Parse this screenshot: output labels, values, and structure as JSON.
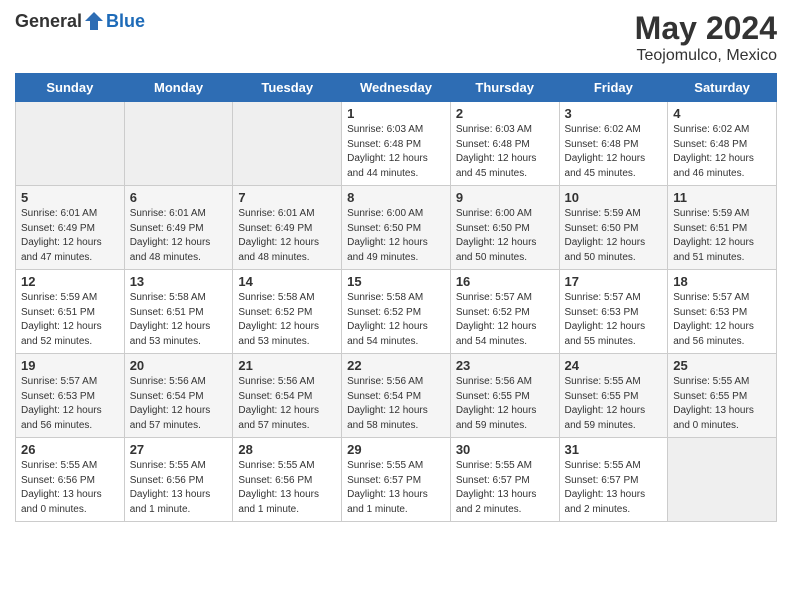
{
  "header": {
    "logo_general": "General",
    "logo_blue": "Blue",
    "month": "May 2024",
    "location": "Teojomulco, Mexico"
  },
  "days_of_week": [
    "Sunday",
    "Monday",
    "Tuesday",
    "Wednesday",
    "Thursday",
    "Friday",
    "Saturday"
  ],
  "weeks": [
    [
      {
        "day": "",
        "info": ""
      },
      {
        "day": "",
        "info": ""
      },
      {
        "day": "",
        "info": ""
      },
      {
        "day": "1",
        "info": "Sunrise: 6:03 AM\nSunset: 6:48 PM\nDaylight: 12 hours\nand 44 minutes."
      },
      {
        "day": "2",
        "info": "Sunrise: 6:03 AM\nSunset: 6:48 PM\nDaylight: 12 hours\nand 45 minutes."
      },
      {
        "day": "3",
        "info": "Sunrise: 6:02 AM\nSunset: 6:48 PM\nDaylight: 12 hours\nand 45 minutes."
      },
      {
        "day": "4",
        "info": "Sunrise: 6:02 AM\nSunset: 6:48 PM\nDaylight: 12 hours\nand 46 minutes."
      }
    ],
    [
      {
        "day": "5",
        "info": "Sunrise: 6:01 AM\nSunset: 6:49 PM\nDaylight: 12 hours\nand 47 minutes."
      },
      {
        "day": "6",
        "info": "Sunrise: 6:01 AM\nSunset: 6:49 PM\nDaylight: 12 hours\nand 48 minutes."
      },
      {
        "day": "7",
        "info": "Sunrise: 6:01 AM\nSunset: 6:49 PM\nDaylight: 12 hours\nand 48 minutes."
      },
      {
        "day": "8",
        "info": "Sunrise: 6:00 AM\nSunset: 6:50 PM\nDaylight: 12 hours\nand 49 minutes."
      },
      {
        "day": "9",
        "info": "Sunrise: 6:00 AM\nSunset: 6:50 PM\nDaylight: 12 hours\nand 50 minutes."
      },
      {
        "day": "10",
        "info": "Sunrise: 5:59 AM\nSunset: 6:50 PM\nDaylight: 12 hours\nand 50 minutes."
      },
      {
        "day": "11",
        "info": "Sunrise: 5:59 AM\nSunset: 6:51 PM\nDaylight: 12 hours\nand 51 minutes."
      }
    ],
    [
      {
        "day": "12",
        "info": "Sunrise: 5:59 AM\nSunset: 6:51 PM\nDaylight: 12 hours\nand 52 minutes."
      },
      {
        "day": "13",
        "info": "Sunrise: 5:58 AM\nSunset: 6:51 PM\nDaylight: 12 hours\nand 53 minutes."
      },
      {
        "day": "14",
        "info": "Sunrise: 5:58 AM\nSunset: 6:52 PM\nDaylight: 12 hours\nand 53 minutes."
      },
      {
        "day": "15",
        "info": "Sunrise: 5:58 AM\nSunset: 6:52 PM\nDaylight: 12 hours\nand 54 minutes."
      },
      {
        "day": "16",
        "info": "Sunrise: 5:57 AM\nSunset: 6:52 PM\nDaylight: 12 hours\nand 54 minutes."
      },
      {
        "day": "17",
        "info": "Sunrise: 5:57 AM\nSunset: 6:53 PM\nDaylight: 12 hours\nand 55 minutes."
      },
      {
        "day": "18",
        "info": "Sunrise: 5:57 AM\nSunset: 6:53 PM\nDaylight: 12 hours\nand 56 minutes."
      }
    ],
    [
      {
        "day": "19",
        "info": "Sunrise: 5:57 AM\nSunset: 6:53 PM\nDaylight: 12 hours\nand 56 minutes."
      },
      {
        "day": "20",
        "info": "Sunrise: 5:56 AM\nSunset: 6:54 PM\nDaylight: 12 hours\nand 57 minutes."
      },
      {
        "day": "21",
        "info": "Sunrise: 5:56 AM\nSunset: 6:54 PM\nDaylight: 12 hours\nand 57 minutes."
      },
      {
        "day": "22",
        "info": "Sunrise: 5:56 AM\nSunset: 6:54 PM\nDaylight: 12 hours\nand 58 minutes."
      },
      {
        "day": "23",
        "info": "Sunrise: 5:56 AM\nSunset: 6:55 PM\nDaylight: 12 hours\nand 59 minutes."
      },
      {
        "day": "24",
        "info": "Sunrise: 5:55 AM\nSunset: 6:55 PM\nDaylight: 12 hours\nand 59 minutes."
      },
      {
        "day": "25",
        "info": "Sunrise: 5:55 AM\nSunset: 6:55 PM\nDaylight: 13 hours\nand 0 minutes."
      }
    ],
    [
      {
        "day": "26",
        "info": "Sunrise: 5:55 AM\nSunset: 6:56 PM\nDaylight: 13 hours\nand 0 minutes."
      },
      {
        "day": "27",
        "info": "Sunrise: 5:55 AM\nSunset: 6:56 PM\nDaylight: 13 hours\nand 1 minute."
      },
      {
        "day": "28",
        "info": "Sunrise: 5:55 AM\nSunset: 6:56 PM\nDaylight: 13 hours\nand 1 minute."
      },
      {
        "day": "29",
        "info": "Sunrise: 5:55 AM\nSunset: 6:57 PM\nDaylight: 13 hours\nand 1 minute."
      },
      {
        "day": "30",
        "info": "Sunrise: 5:55 AM\nSunset: 6:57 PM\nDaylight: 13 hours\nand 2 minutes."
      },
      {
        "day": "31",
        "info": "Sunrise: 5:55 AM\nSunset: 6:57 PM\nDaylight: 13 hours\nand 2 minutes."
      },
      {
        "day": "",
        "info": ""
      }
    ]
  ]
}
